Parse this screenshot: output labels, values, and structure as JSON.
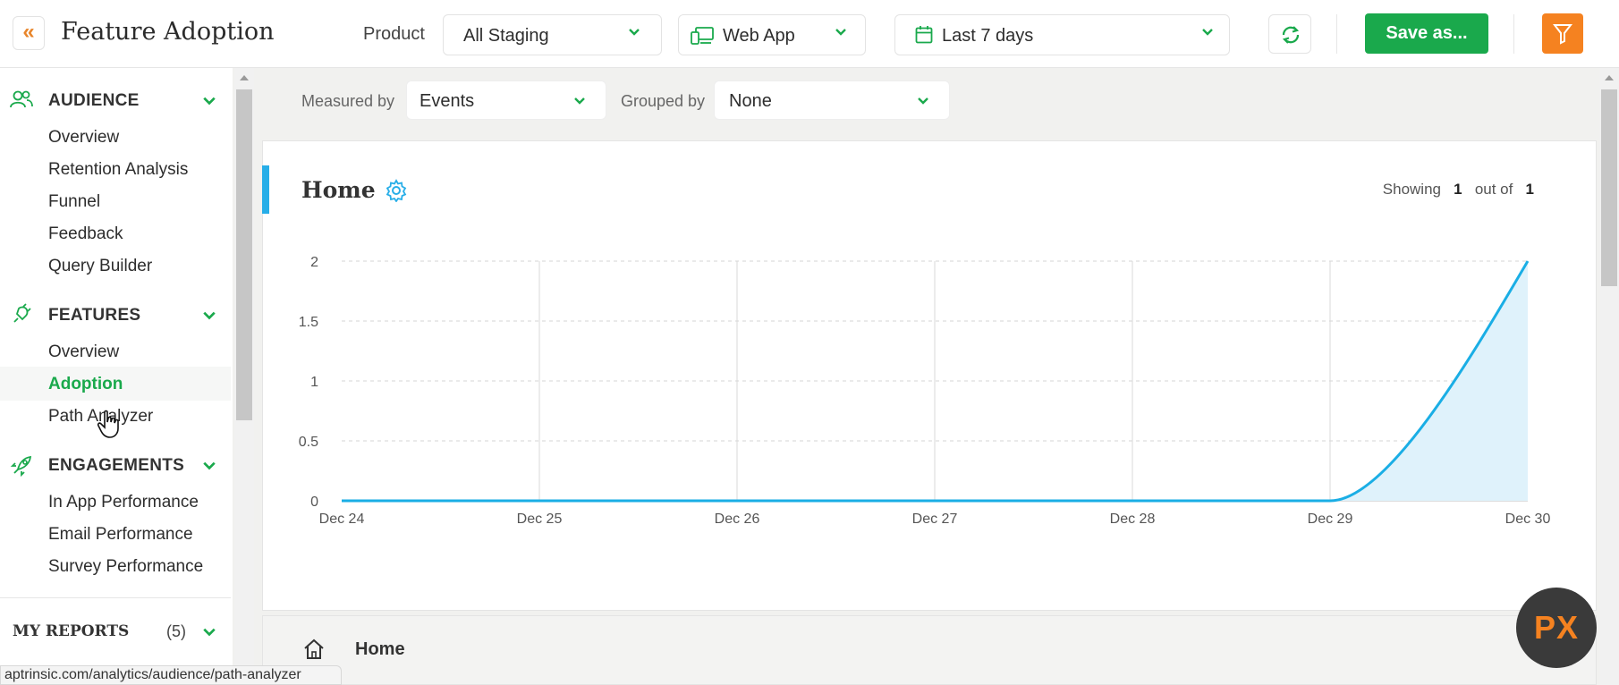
{
  "header": {
    "title": "Feature Adoption",
    "product_label": "Product",
    "product_value": "All Staging",
    "app_value": "Web App",
    "date_value": "Last 7 days",
    "save_label": "Save as..."
  },
  "sidebar": {
    "sections": [
      {
        "title": "AUDIENCE",
        "icon": "users-icon",
        "items": [
          "Overview",
          "Retention Analysis",
          "Funnel",
          "Feedback",
          "Query Builder"
        ]
      },
      {
        "title": "FEATURES",
        "icon": "plug-icon",
        "items": [
          "Overview",
          "Adoption",
          "Path Analyzer"
        ],
        "active": "Adoption"
      },
      {
        "title": "ENGAGEMENTS",
        "icon": "rocket-icon",
        "items": [
          "In App Performance",
          "Email Performance",
          "Survey Performance"
        ]
      }
    ],
    "reports": {
      "title": "MY REPORTS",
      "count": "(5)"
    }
  },
  "filters": {
    "measured_label": "Measured by",
    "measured_value": "Events",
    "grouped_label": "Grouped by",
    "grouped_value": "None"
  },
  "card": {
    "title": "Home",
    "showing_prefix": "Showing",
    "showing_count": "1",
    "showing_mid": "out of",
    "showing_total": "1"
  },
  "chart_data": {
    "type": "area",
    "x": [
      "Dec 24",
      "Dec 25",
      "Dec 26",
      "Dec 27",
      "Dec 28",
      "Dec 29",
      "Dec 30"
    ],
    "series": [
      {
        "values": [
          0,
          0,
          0,
          0,
          0,
          0,
          2
        ]
      }
    ],
    "y_ticks": [
      "0",
      "0.5",
      "1",
      "1.5",
      "2"
    ],
    "ylim": [
      0,
      2
    ],
    "colors": {
      "line": "#1aaee5",
      "fill": "#dff2fb"
    },
    "grid": true
  },
  "row2": {
    "label": "Home"
  },
  "status_url": "aptrinsic.com/analytics/audience/path-analyzer",
  "badge": "PX",
  "colors": {
    "accent_green": "#1aa94c",
    "accent_orange": "#f58220",
    "accent_blue": "#27aee8"
  }
}
